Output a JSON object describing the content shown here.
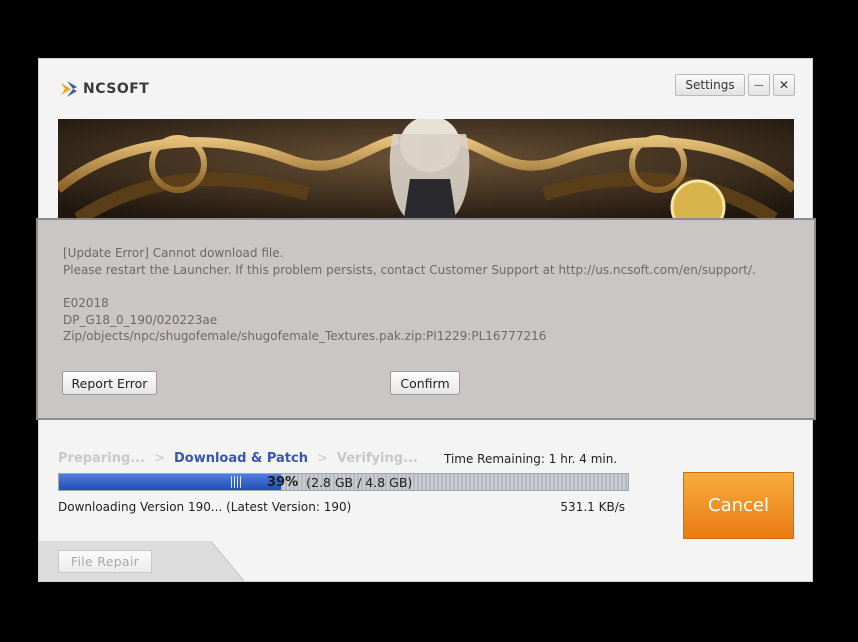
{
  "app": {
    "brand": "NCSOFT"
  },
  "header": {
    "settings_label": "Settings",
    "minimize_label": "—",
    "close_label": "✕"
  },
  "error_dialog": {
    "lines": [
      "[Update Error] Cannot download file.",
      "Please restart the Launcher. If this problem persists, contact Customer Support at http://us.ncsoft.com/en/support/.",
      "E02018",
      "DP_G18_0_190/020223ae",
      "Zip/objects/npc/shugofemale/shugofemale_Textures.pak.zip:PI1229:PL16777216"
    ],
    "report_label": "Report Error",
    "confirm_label": "Confirm"
  },
  "steps": {
    "items": [
      "Preparing...",
      "Download & Patch",
      "Verifying..."
    ],
    "separator": ">",
    "active_index": 1
  },
  "time_remaining": "Time Remaining: 1 hr. 4 min.",
  "progress": {
    "percent_label": "39%",
    "percent_value": 39,
    "size_label": "(2.8 GB / 4.8 GB)"
  },
  "status": {
    "downloading": "Downloading Version 190... (Latest Version: 190)",
    "speed": "531.1 KB/s"
  },
  "cancel_label": "Cancel",
  "file_repair_label": "File Repair",
  "colors": {
    "accent_orange": "#f39a2a",
    "progress_blue": "#2e5fc8",
    "active_step": "#3a55b0"
  }
}
